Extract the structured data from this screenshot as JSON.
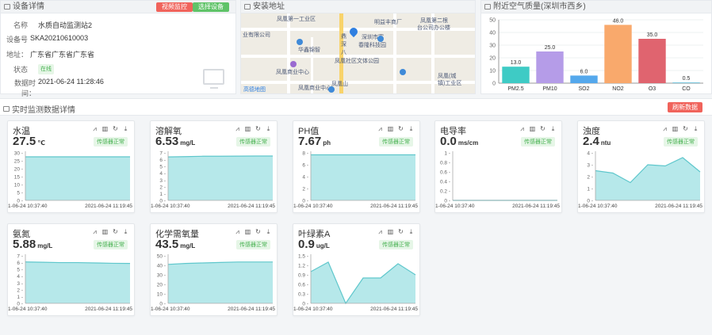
{
  "device": {
    "title": "设备详情",
    "btn_video": "视频监控",
    "btn_select": "选择设备",
    "rows": [
      {
        "key": "名称",
        "value": "水质自动监测站2"
      },
      {
        "key": "设备号",
        "value": "SKA20210610003"
      },
      {
        "key": "地址：",
        "value": "广东省广东省广东省"
      },
      {
        "key": "状态",
        "value": "在线"
      },
      {
        "key": "数据时间：",
        "value": "2021-06-24 11:28:46"
      }
    ]
  },
  "map": {
    "title": "安装地址",
    "labels": [
      "凤凰第一工业区",
      "明益丰商厂",
      "凤凰第二根",
      "台公司办公楼",
      "业有限公司",
      "深圳市富",
      "春隆科技园",
      "华鑫锦智",
      "凤凰社区文体公园",
      "凤凰商业中心",
      "凤凰商业中心",
      "凤凰(城",
      "镇)工业区",
      "凤凰山",
      "鼎",
      "深",
      "八"
    ],
    "logo": "高德地图"
  },
  "air": {
    "title": "附近空气质量(深圳市西乡)"
  },
  "chart_data": [
    {
      "type": "bar",
      "categories": [
        "PM2.5",
        "PM10",
        "SO2",
        "NO2",
        "O3",
        "CO"
      ],
      "values": [
        13.0,
        25.0,
        6.0,
        46.0,
        35.0,
        0.5
      ],
      "value_labels": [
        "13.0",
        "25.0",
        "6.0",
        "46.0",
        "35.0",
        "0.5"
      ],
      "colors": [
        "#3ecbc5",
        "#b59ce8",
        "#54a8ec",
        "#f9a96c",
        "#e0646f",
        "#56b8d6"
      ],
      "ylim": [
        0,
        50
      ],
      "yticks": [
        "0",
        "10",
        "20",
        "30",
        "40",
        "50"
      ]
    },
    {
      "type": "area",
      "name": "水温",
      "ylim": [
        0,
        30
      ],
      "yticks": [
        "0",
        "5",
        "10",
        "15",
        "20",
        "25",
        "30"
      ],
      "x": [
        "2021-06-24 10:37:40",
        "2021-06-24 11:19:45"
      ],
      "values": [
        27.5,
        27.5,
        27.5,
        27.5,
        27.5,
        27.5,
        27.5
      ]
    },
    {
      "type": "area",
      "name": "溶解氧",
      "ylim": [
        0,
        7
      ],
      "yticks": [
        "0",
        "1",
        "2",
        "3",
        "4",
        "5",
        "6",
        "7"
      ],
      "x": [
        "2021-06-24 10:37:40",
        "2021-06-24 11:19:45"
      ],
      "values": [
        6.4,
        6.45,
        6.5,
        6.5,
        6.52,
        6.53,
        6.53
      ]
    },
    {
      "type": "area",
      "name": "PH值",
      "ylim": [
        0,
        8
      ],
      "yticks": [
        "0",
        "2",
        "4",
        "6",
        "8"
      ],
      "x": [
        "2021-06-24 10:37:40",
        "2021-06-24 11:19:45"
      ],
      "values": [
        7.67,
        7.67,
        7.67,
        7.67,
        7.67,
        7.67,
        7.67
      ]
    },
    {
      "type": "area",
      "name": "电导率",
      "ylim": [
        0,
        1
      ],
      "yticks": [
        "0",
        "0.2",
        "0.4",
        "0.6",
        "0.8",
        "1"
      ],
      "x": [
        "2021-06-24 10:37:40",
        "2021-06-24 11:19:45"
      ],
      "values": [
        0,
        0,
        0,
        0,
        0,
        0,
        0
      ]
    },
    {
      "type": "area",
      "name": "浊度",
      "ylim": [
        0,
        4
      ],
      "yticks": [
        "0",
        "1",
        "2",
        "3",
        "4"
      ],
      "x": [
        "2021-06-24 10:37:40",
        "2021-06-24 11:19:45"
      ],
      "values": [
        2.5,
        2.3,
        1.5,
        3.0,
        2.9,
        3.6,
        2.4
      ]
    },
    {
      "type": "area",
      "name": "氨氮",
      "ylim": [
        0,
        7
      ],
      "yticks": [
        "0",
        "1",
        "2",
        "3",
        "4",
        "5",
        "6",
        "7"
      ],
      "x": [
        "2021-06-24 10:37:40",
        "2021-06-24 11:19:45"
      ],
      "values": [
        6.1,
        6.05,
        6.0,
        6.0,
        5.95,
        5.9,
        5.88
      ]
    },
    {
      "type": "area",
      "name": "化学需氧量",
      "ylim": [
        0,
        50
      ],
      "yticks": [
        "0",
        "10",
        "20",
        "30",
        "40",
        "50"
      ],
      "x": [
        "2021-06-24 10:37:40",
        "2021-06-24 11:19:45"
      ],
      "values": [
        41,
        42,
        42.5,
        43,
        43.5,
        43.5,
        43.5
      ]
    },
    {
      "type": "area",
      "name": "叶绿素A",
      "ylim": [
        0,
        1.5
      ],
      "yticks": [
        "0",
        "0.3",
        "0.6",
        "0.9",
        "1.2",
        "1.5"
      ],
      "x": [
        "2021-06-24 10:37:40",
        "2021-06-24 11:19:45"
      ],
      "values": [
        1.0,
        1.3,
        0.0,
        0.8,
        0.8,
        1.25,
        0.9
      ]
    }
  ],
  "realtime": {
    "title": "实时监测数据详情",
    "refresh": "刷新数据",
    "x_left": "1-06-24 10:37:40",
    "x_right": "2021-06-24 11:19:45",
    "status": "传感器正常",
    "sensors": [
      {
        "name": "水温",
        "value": "27.5",
        "unit": "℃"
      },
      {
        "name": "溶解氧",
        "value": "6.53",
        "unit": "mg/L"
      },
      {
        "name": "PH值",
        "value": "7.67",
        "unit": "ph"
      },
      {
        "name": "电导率",
        "value": "0.0",
        "unit": "ms/cm"
      },
      {
        "name": "浊度",
        "value": "2.4",
        "unit": "ntu"
      },
      {
        "name": "氨氮",
        "value": "5.88",
        "unit": "mg/L"
      },
      {
        "name": "化学需氧量",
        "value": "43.5",
        "unit": "mg/L"
      },
      {
        "name": "叶绿素A",
        "value": "0.9",
        "unit": "ug/L"
      }
    ]
  },
  "colors": {
    "area_fill": "#a9e4e6",
    "area_line": "#5fc7cc",
    "danger": "#f0635b",
    "success": "#5fc368"
  }
}
